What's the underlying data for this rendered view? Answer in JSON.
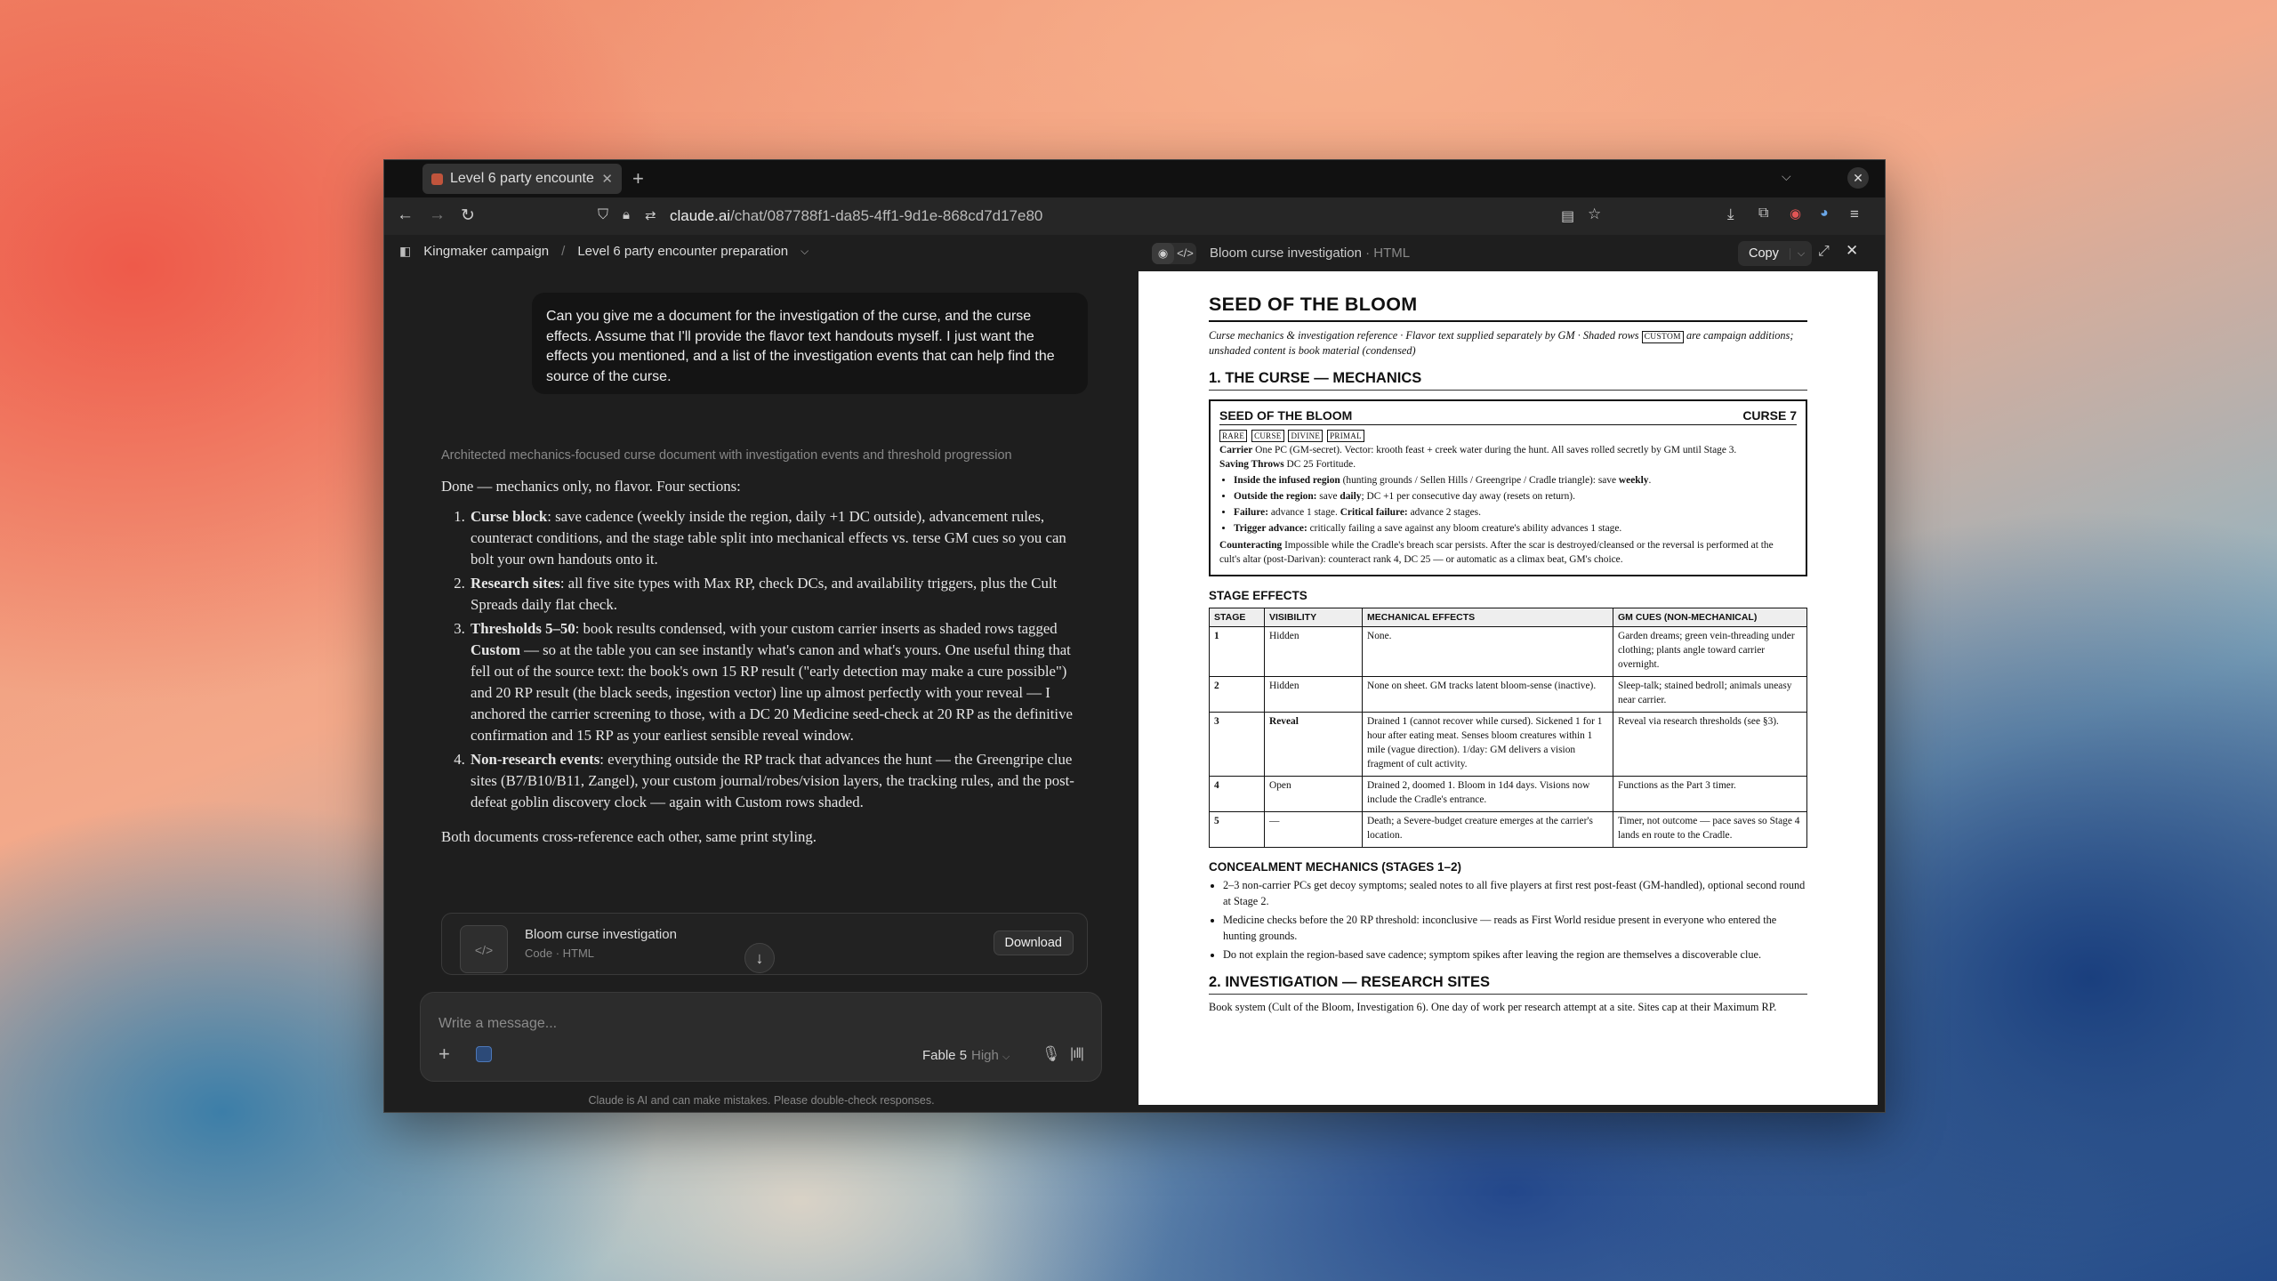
{
  "browser": {
    "tab_title": "Level 6 party encounter",
    "url_domain": "claude.ai",
    "url_path": "/chat/087788f1-da85-4ff1-9d1e-868cd7d17e80"
  },
  "breadcrumb": {
    "project": "Kingmaker campaign",
    "chat": "Level 6 party encounter preparation"
  },
  "user_message": "Can you give me a document for the investigation of the curse, and the curse effects. Assume that I'll provide the flavor text handouts myself. I just want the effects you mentioned, and a list of the investigation events that can help find the source of the curse.",
  "thinking": "Architected mechanics-focused curse document with investigation events and threshold progression",
  "response": {
    "intro": "Done — mechanics only, no flavor. Four sections:",
    "items": [
      {
        "title": "Curse block",
        "text": ": save cadence (weekly inside the region, daily +1 DC outside), advancement rules, counteract conditions, and the stage table split into mechanical effects vs. terse GM cues so you can bolt your own handouts onto it."
      },
      {
        "title": "Research sites",
        "text": ": all five site types with Max RP, check DCs, and availability triggers, plus the Cult Spreads daily flat check."
      },
      {
        "title": "Thresholds 5–50",
        "text_a": ": book results condensed, with your custom carrier inserts as shaded rows tagged ",
        "bold": "Custom",
        "text_b": " — so at the table you can see instantly what's canon and what's yours. One useful thing that fell out of the source text: the book's own 15 RP result (\"early detection may make a cure possible\") and 20 RP result (the black seeds, ingestion vector) line up almost perfectly with your reveal — I anchored the carrier screening to those, with a DC 20 Medicine seed-check at 20 RP as the definitive confirmation and 15 RP as your earliest sensible reveal window."
      },
      {
        "title": "Non-research events",
        "text": ": everything outside the RP track that advances the hunt — the Greengripe clue sites (B7/B10/B11, Zangel), your custom journal/robes/vision layers, the tracking rules, and the post-defeat goblin discovery clock — again with Custom rows shaded."
      }
    ],
    "outro": "Both documents cross-reference each other, same print styling."
  },
  "artifact": {
    "name": "Bloom curse investigation",
    "subtitle": "Code · HTML",
    "download": "Download"
  },
  "composer": {
    "placeholder": "Write a message...",
    "model": "Fable 5",
    "effort": "High"
  },
  "disclaimer": "Claude is AI and can make mistakes. Please double-check responses.",
  "panel": {
    "title": "Bloom curse investigation",
    "type": "· HTML",
    "copy": "Copy"
  },
  "doc": {
    "title": "SEED OF THE BLOOM",
    "subtitle_a": "Curse mechanics & investigation reference · Flavor text supplied separately by GM · Shaded rows ",
    "custom_tag": "CUSTOM",
    "subtitle_b": " are campaign additions; unshaded content is book material (condensed)",
    "section1": "1. THE CURSE — MECHANICS",
    "statblock": {
      "name": "SEED OF THE BLOOM",
      "level": "CURSE 7",
      "traits": [
        "RARE",
        "CURSE",
        "DIVINE",
        "PRIMAL"
      ],
      "carrier_label": "Carrier",
      "carrier": " One PC (GM-secret). Vector: krooth feast + creek water during the hunt. All saves rolled secretly by GM until Stage 3.",
      "saving_label": "Saving Throws",
      "saving": " DC 25 Fortitude.",
      "bullets": [
        {
          "b": "Inside the infused region",
          "t": " (hunting grounds / Sellen Hills / Greengripe / Cradle triangle): save ",
          "b2": "weekly",
          "t2": "."
        },
        {
          "b": "Outside the region:",
          "t": " save ",
          "b2": "daily",
          "t2": "; DC +1 per consecutive day away (resets on return)."
        },
        {
          "b": "Failure:",
          "t": " advance 1 stage. ",
          "b2": "Critical failure:",
          "t2": " advance 2 stages."
        },
        {
          "b": "Trigger advance:",
          "t": " critically failing a save against any bloom creature's ability advances 1 stage.",
          "b2": "",
          "t2": ""
        }
      ],
      "counter_label": "Counteracting",
      "counter": " Impossible while the Cradle's breach scar persists. After the scar is destroyed/cleansed or the reversal is performed at the cult's altar (post-Darivan): counteract rank 4, DC 25 — or automatic as a climax beat, GM's choice."
    },
    "stage_heading": "STAGE EFFECTS",
    "stage_headers": [
      "STAGE",
      "VISIBILITY",
      "MECHANICAL EFFECTS",
      "GM CUES (NON-MECHANICAL)"
    ],
    "stages": [
      {
        "stage": "1",
        "vis": "Hidden",
        "mech": "None.",
        "cue": "Garden dreams; green vein-threading under clothing; plants angle toward carrier overnight."
      },
      {
        "stage": "2",
        "vis": "Hidden",
        "mech": "None on sheet. GM tracks latent bloom-sense (inactive).",
        "cue": "Sleep-talk; stained bedroll; animals uneasy near carrier."
      },
      {
        "stage": "3",
        "vis": "Reveal",
        "mech": "Drained 1 (cannot recover while cursed). Sickened 1 for 1 hour after eating meat. Senses bloom creatures within 1 mile (vague direction). 1/day: GM delivers a vision fragment of cult activity.",
        "cue": "Reveal via research thresholds (see §3)."
      },
      {
        "stage": "4",
        "vis": "Open",
        "mech": "Drained 2, doomed 1. Bloom in 1d4 days. Visions now include the Cradle's entrance.",
        "cue": "Functions as the Part 3 timer."
      },
      {
        "stage": "5",
        "vis": "—",
        "mech": "Death; a Severe-budget creature emerges at the carrier's location.",
        "cue": "Timer, not outcome — pace saves so Stage 4 lands en route to the Cradle."
      }
    ],
    "conceal_heading": "CONCEALMENT MECHANICS (STAGES 1–2)",
    "conceal": [
      "2–3 non-carrier PCs get decoy symptoms; sealed notes to all five players at first rest post-feast (GM-handled), optional second round at Stage 2.",
      "Medicine checks before the 20 RP threshold: inconclusive — reads as First World residue present in everyone who entered the hunting grounds.",
      "Do not explain the region-based save cadence; symptom spikes after leaving the region are themselves a discoverable clue."
    ],
    "section2": "2. INVESTIGATION — RESEARCH SITES",
    "section2_body": "Book system (Cult of the Bloom, Investigation 6). One day of work per research attempt at a site. Sites cap at their Maximum RP."
  }
}
